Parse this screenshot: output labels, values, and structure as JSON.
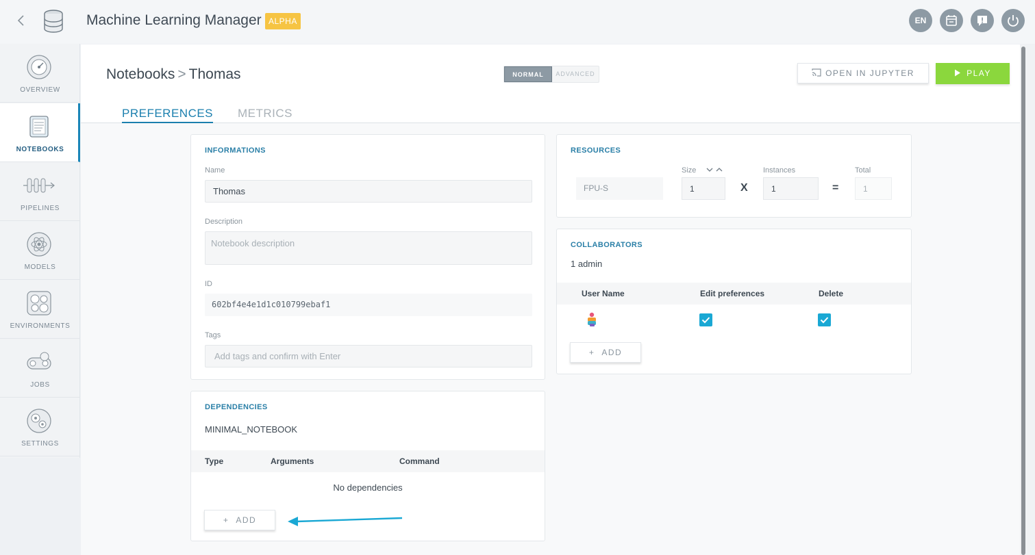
{
  "header": {
    "app_title": "Machine Learning Manager",
    "badge": "ALPHA",
    "lang": "EN",
    "icons": [
      "calendar-icon",
      "feedback-icon",
      "power-icon"
    ]
  },
  "sidebar": {
    "items": [
      {
        "label": "OVERVIEW",
        "icon": "dashboard-gauge-icon"
      },
      {
        "label": "NOTEBOOKS",
        "icon": "notebook-icon",
        "active": true
      },
      {
        "label": "PIPELINES",
        "icon": "pipeline-icon"
      },
      {
        "label": "MODELS",
        "icon": "atom-model-icon"
      },
      {
        "label": "ENVIRONMENTS",
        "icon": "cluster-icon"
      },
      {
        "label": "JOBS",
        "icon": "conveyor-icon"
      },
      {
        "label": "SETTINGS",
        "icon": "gears-icon"
      }
    ]
  },
  "page": {
    "breadcrumb_root": "Notebooks",
    "breadcrumb_sep": ">",
    "breadcrumb_current": "Thomas",
    "mode_normal": "NORMAL",
    "mode_advanced": "ADVANCED",
    "open_jupyter": "OPEN IN JUPYTER",
    "play": "PLAY",
    "tabs": [
      "PREFERENCES",
      "METRICS"
    ]
  },
  "informations": {
    "title": "INFORMATIONS",
    "name_label": "Name",
    "name_value": "Thomas",
    "description_label": "Description",
    "description_placeholder": "Notebook description",
    "id_label": "ID",
    "id_value": "602bf4e4e1d1c010799ebaf1",
    "tags_label": "Tags",
    "tags_placeholder": "Add tags and confirm with Enter"
  },
  "dependencies": {
    "title": "DEPENDENCIES",
    "base": "MINIMAL_NOTEBOOK",
    "columns": [
      "Type",
      "Arguments",
      "Command"
    ],
    "empty": "No dependencies",
    "add": "ADD",
    "add_symbol": "+"
  },
  "resources": {
    "title": "RESOURCES",
    "type_value": "FPU-S",
    "size_label": "Size",
    "size_value": "1",
    "instances_label": "Instances",
    "instances_value": "1",
    "total_label": "Total",
    "total_value": "1",
    "multiply": "X",
    "equals": "="
  },
  "collaborators": {
    "title": "COLLABORATORS",
    "summary": "1 admin",
    "columns": [
      "User Name",
      "Edit preferences",
      "Delete"
    ],
    "rows": [
      {
        "avatar": "user-avatar-icon",
        "edit_preferences": true,
        "delete": true
      }
    ],
    "add": "ADD",
    "add_symbol": "+"
  },
  "colors": {
    "accent": "#1b7fae",
    "play": "#8bd73d",
    "badge": "#f6c443",
    "checkbox": "#1aa8d4",
    "annotation_arrow": "#1aa8d4"
  }
}
